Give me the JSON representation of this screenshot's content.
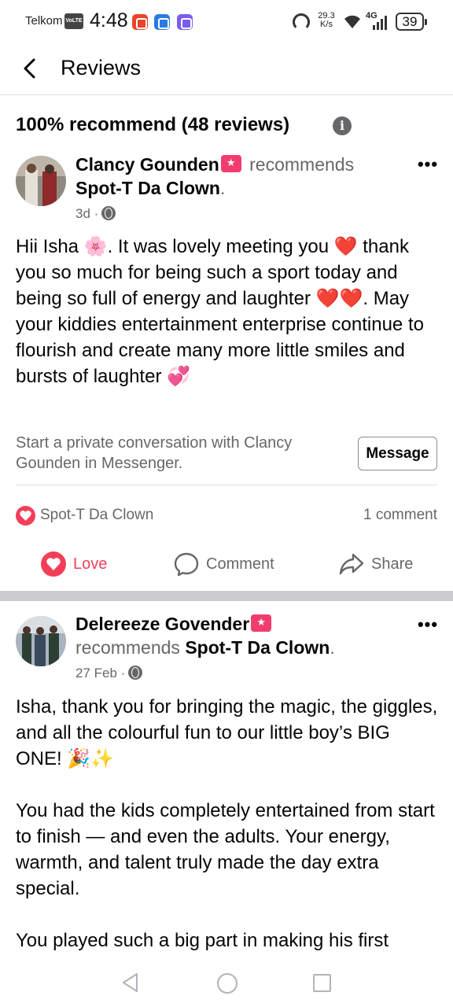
{
  "status_bar": {
    "carrier": "Telkom",
    "volte": "VoLTE",
    "time": "4:48",
    "speed_value": "29.3",
    "speed_unit": "K/s",
    "network": "4G",
    "battery": "39"
  },
  "header": {
    "back_icon": "chevron-left-icon",
    "title": "Reviews"
  },
  "summary": {
    "text": "100% recommend (48 reviews)",
    "info_icon": "i"
  },
  "reviews": [
    {
      "author": "Clancy Gounden",
      "verb": "recommends",
      "page": "Spot-T Da Clown",
      "time": "3d",
      "body": "Hii Isha 🌸. It was lovely meeting you ❤️ thank you so much for being such a sport today and being so full of energy and laughter ❤️❤️. May your kiddies entertainment enterprise continue to flourish and create many more little smiles and bursts of laughter 💞",
      "message_prompt": "Start a private conversation with Clancy Gounden in Messenger.",
      "message_button": "Message",
      "reaction_name": "Spot-T Da Clown",
      "comment_count": "1 comment",
      "actions": {
        "love": "Love",
        "comment": "Comment",
        "share": "Share"
      }
    },
    {
      "author": "Delereeze Govender",
      "verb": "recommends",
      "page": "Spot-T Da Clown",
      "time": "27 Feb",
      "body": "Isha, thank you for bringing the magic, the giggles, and all the colourful fun to our little boy’s BIG ONE! 🎉✨\n\nYou had the kids completely entertained from start to finish — and even the adults. Your energy, warmth, and talent truly made the day extra special.\n\nYou played such a big part in making his first"
    }
  ],
  "colors": {
    "accent_love": "#f33e58",
    "badge": "#f13c6e",
    "muted_text": "#65676b"
  }
}
